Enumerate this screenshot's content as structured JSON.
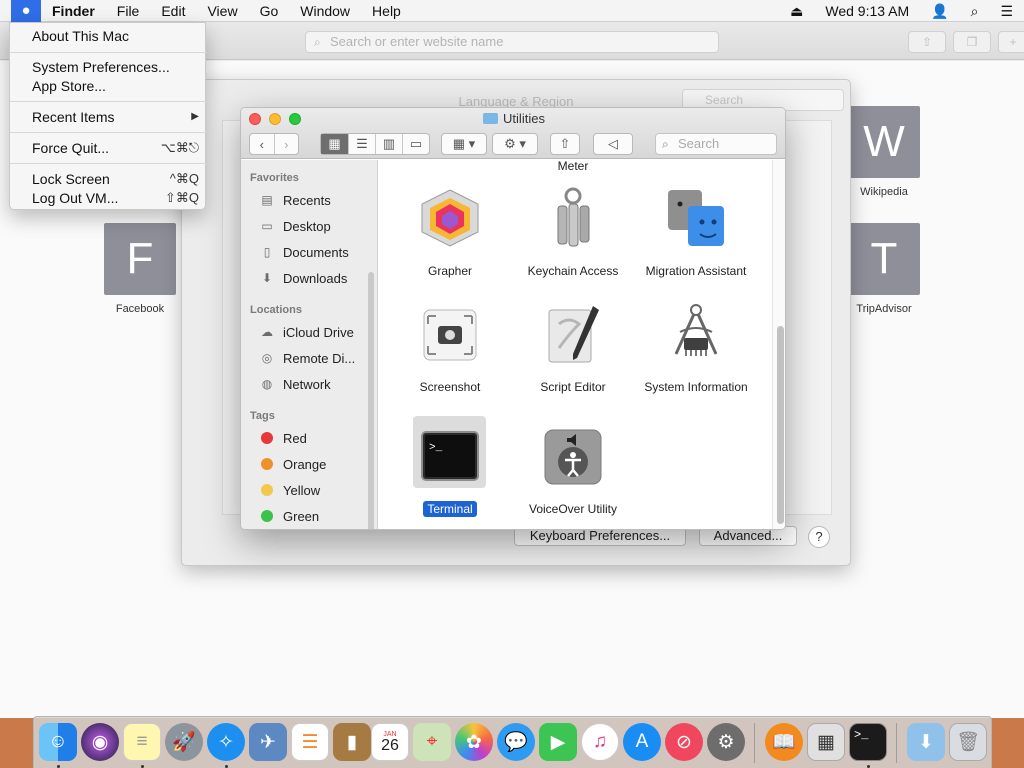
{
  "menubar": {
    "apple_icon": "apple-icon",
    "items": [
      "Finder",
      "File",
      "Edit",
      "View",
      "Go",
      "Window",
      "Help"
    ],
    "clock": "Wed 9:13 AM",
    "right_icons": [
      "eject-icon",
      "user-icon",
      "search-icon",
      "menu-list-icon"
    ]
  },
  "apple_menu": {
    "about": "About This Mac",
    "system_prefs": "System Preferences...",
    "app_store": "App Store...",
    "recent_items": "Recent Items",
    "recent_items_arrow": "▶",
    "force_quit": "Force Quit...",
    "force_quit_shortcut": "⌥⌘⎋",
    "lock_screen": "Lock Screen",
    "lock_screen_shortcut": "^⌘Q",
    "log_out": "Log Out VM...",
    "log_out_shortcut": "⇧⌘Q"
  },
  "safari": {
    "url_placeholder": "Search or enter website name",
    "favorites": [
      {
        "letter": "F",
        "label": "Facebook"
      },
      {
        "letter": "W",
        "label": "Wikipedia"
      },
      {
        "letter": "T",
        "label": "TripAdvisor"
      }
    ]
  },
  "prefs": {
    "title": "Language & Region",
    "search_placeholder": "Search",
    "keyboard_button": "Keyboard Preferences...",
    "advanced_button": "Advanced...",
    "help_button": "?"
  },
  "finder": {
    "title": "Utilities",
    "search_placeholder": "Search",
    "sidebar": {
      "favorites_header": "Favorites",
      "favorites": [
        "Recents",
        "Desktop",
        "Documents",
        "Downloads"
      ],
      "locations_header": "Locations",
      "locations": [
        "iCloud Drive",
        "Remote Di...",
        "Network"
      ],
      "tags_header": "Tags",
      "tags": [
        {
          "label": "Red",
          "color": "#e5383b"
        },
        {
          "label": "Orange",
          "color": "#f0902d"
        },
        {
          "label": "Yellow",
          "color": "#f2c94c"
        },
        {
          "label": "Green",
          "color": "#3cc24a"
        }
      ]
    },
    "files": {
      "cut_label": "Meter",
      "items": [
        {
          "name": "Grapher",
          "icon": "grapher-icon"
        },
        {
          "name": "Keychain Access",
          "icon": "keychain-icon"
        },
        {
          "name": "Migration Assistant",
          "icon": "migration-icon"
        },
        {
          "name": "Screenshot",
          "icon": "screenshot-icon"
        },
        {
          "name": "Script Editor",
          "icon": "script-editor-icon"
        },
        {
          "name": "System Information",
          "icon": "system-info-icon"
        },
        {
          "name": "Terminal",
          "icon": "terminal-icon",
          "selected": true
        },
        {
          "name": "VoiceOver Utility",
          "icon": "voiceover-icon"
        }
      ]
    }
  },
  "dock": {
    "apps": [
      "finder",
      "siri",
      "launchpad",
      "safari",
      "mail",
      "notes",
      "reminders",
      "contacts",
      "calendar",
      "maps",
      "photos",
      "messages",
      "facetime",
      "itunes",
      "app-store",
      "news",
      "system-preferences",
      "books",
      "calculator",
      "terminal",
      "downloads-folder",
      "trash"
    ],
    "calendar_month": "JAN",
    "calendar_day": "26"
  }
}
